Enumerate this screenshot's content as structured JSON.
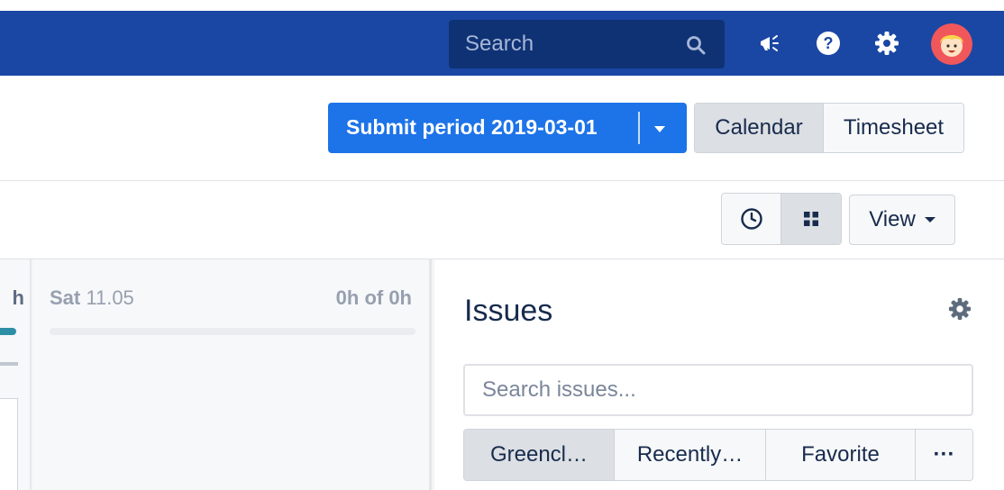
{
  "navbar": {
    "search_placeholder": "Search",
    "icons": [
      "search-icon",
      "megaphone-icon",
      "help-icon",
      "gear-icon",
      "avatar"
    ],
    "color": "#1a47a3"
  },
  "header": {
    "submit_label": "Submit period 2019-03-01",
    "view_modes": [
      "Calendar",
      "Timesheet"
    ],
    "active_view_mode": "Calendar",
    "accent": "#1d73e8"
  },
  "toolbar": {
    "toggle_icons": [
      "clock-icon",
      "grid-icon"
    ],
    "view_label": "View"
  },
  "days": {
    "previous_hours": "h",
    "saturday": {
      "day_name": "Sat",
      "date": "11.05",
      "hours": "0h of 0h"
    }
  },
  "issues_panel": {
    "title": "Issues",
    "search_placeholder": "Search issues...",
    "filters": [
      "Greencl…",
      "Recently…",
      "Favorite",
      "···"
    ],
    "active_filter": "Greencl…"
  }
}
